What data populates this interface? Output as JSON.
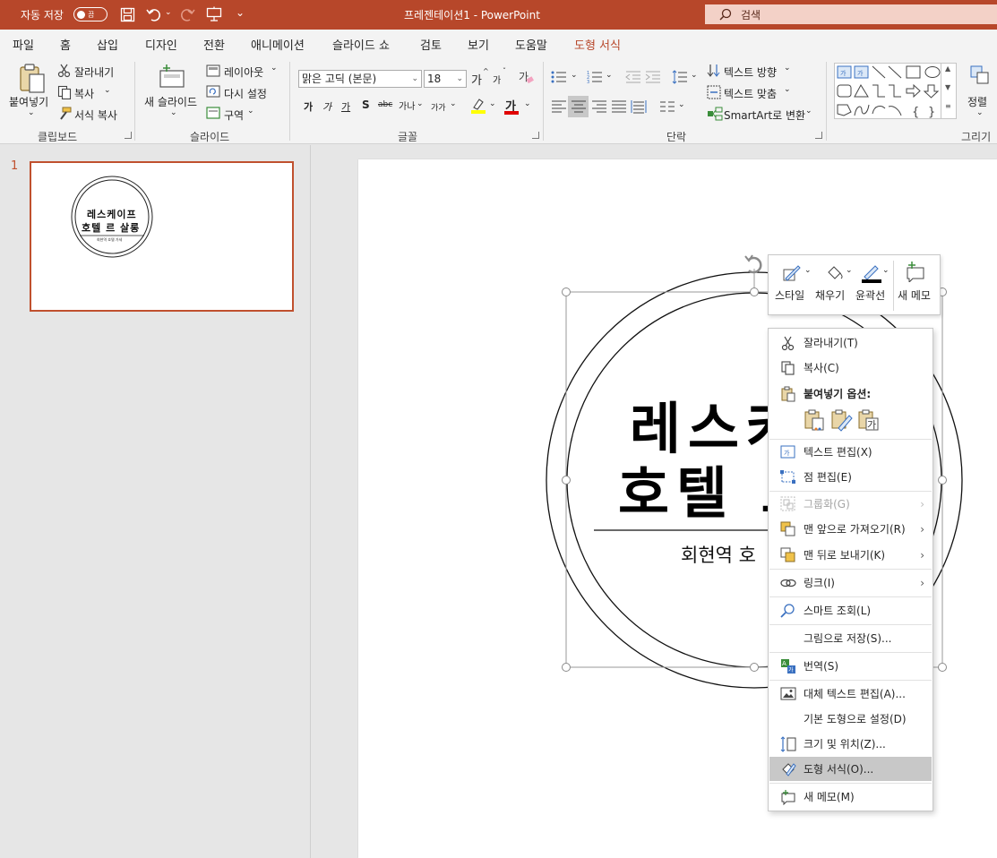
{
  "titlebar": {
    "autosave_label": "자동 저장",
    "autosave_state": "끔",
    "doc_title": "프레젠테이션1  -  PowerPoint",
    "search_placeholder": "검색"
  },
  "tabs": [
    {
      "label": "파일"
    },
    {
      "label": "홈"
    },
    {
      "label": "삽입"
    },
    {
      "label": "디자인"
    },
    {
      "label": "전환"
    },
    {
      "label": "애니메이션"
    },
    {
      "label": "슬라이드 쇼"
    },
    {
      "label": "검토"
    },
    {
      "label": "보기"
    },
    {
      "label": "도움말"
    },
    {
      "label": "도형 서식"
    }
  ],
  "ribbon": {
    "clipboard": {
      "label": "클립보드",
      "paste": "붙여넣기",
      "cut": "잘라내기",
      "copy": "복사",
      "format_painter": "서식 복사"
    },
    "slides": {
      "label": "슬라이드",
      "new_slide": "새 슬라이드",
      "layout": "레이아웃",
      "reset": "다시 설정",
      "section": "구역"
    },
    "font": {
      "label": "글꼴",
      "font_name": "맑은 고딕 (본문)",
      "font_size": "18",
      "grow": "가",
      "shrink": "가",
      "bold": "가",
      "italic": "가",
      "underline": "가",
      "strike": "S",
      "strikethrough": "abc",
      "spacing": "가나",
      "case": "가가",
      "font_color": "가",
      "highlight_color": "#ffff00",
      "font_color_bar": "#e00000"
    },
    "paragraph": {
      "label": "단락",
      "text_direction": "텍스트 방향",
      "align_text": "텍스트 맞춤",
      "smartart": "SmartArt로 변환"
    },
    "drawing": {
      "label": "그리기",
      "arrange": "정렬"
    }
  },
  "slide_pane": {
    "slide_number": "1",
    "thumb_title_line1": "레스케이프",
    "thumb_title_line2": "호텔 르 살롱",
    "thumb_subtitle": "회현역 호텔 가세"
  },
  "slide": {
    "title_line1": "레스커",
    "title_line2": "호텔 르",
    "subtitle": "회현역 호"
  },
  "mini_toolbar": {
    "style": "스타일",
    "fill": "채우기",
    "outline": "윤곽선",
    "new_comment": "새 메모"
  },
  "context_menu": {
    "cut": "잘라내기(T)",
    "copy": "복사(C)",
    "paste_options": "붙여넣기 옵션:",
    "paste_opt_letter": "가",
    "edit_text": "텍스트 편집(X)",
    "edit_points": "점 편집(E)",
    "group": "그룹화(G)",
    "bring_front": "맨 앞으로 가져오기(R)",
    "send_back": "맨 뒤로 보내기(K)",
    "link": "링크(I)",
    "smart_lookup": "스마트 조회(L)",
    "save_as_picture": "그림으로 저장(S)...",
    "translate": "번역(S)",
    "edit_alt_text": "대체 텍스트 편집(A)...",
    "set_default": "기본 도형으로 설정(D)",
    "size_position": "크기 및 위치(Z)...",
    "format_shape": "도형 서식(O)...",
    "new_comment": "새 메모(M)"
  }
}
